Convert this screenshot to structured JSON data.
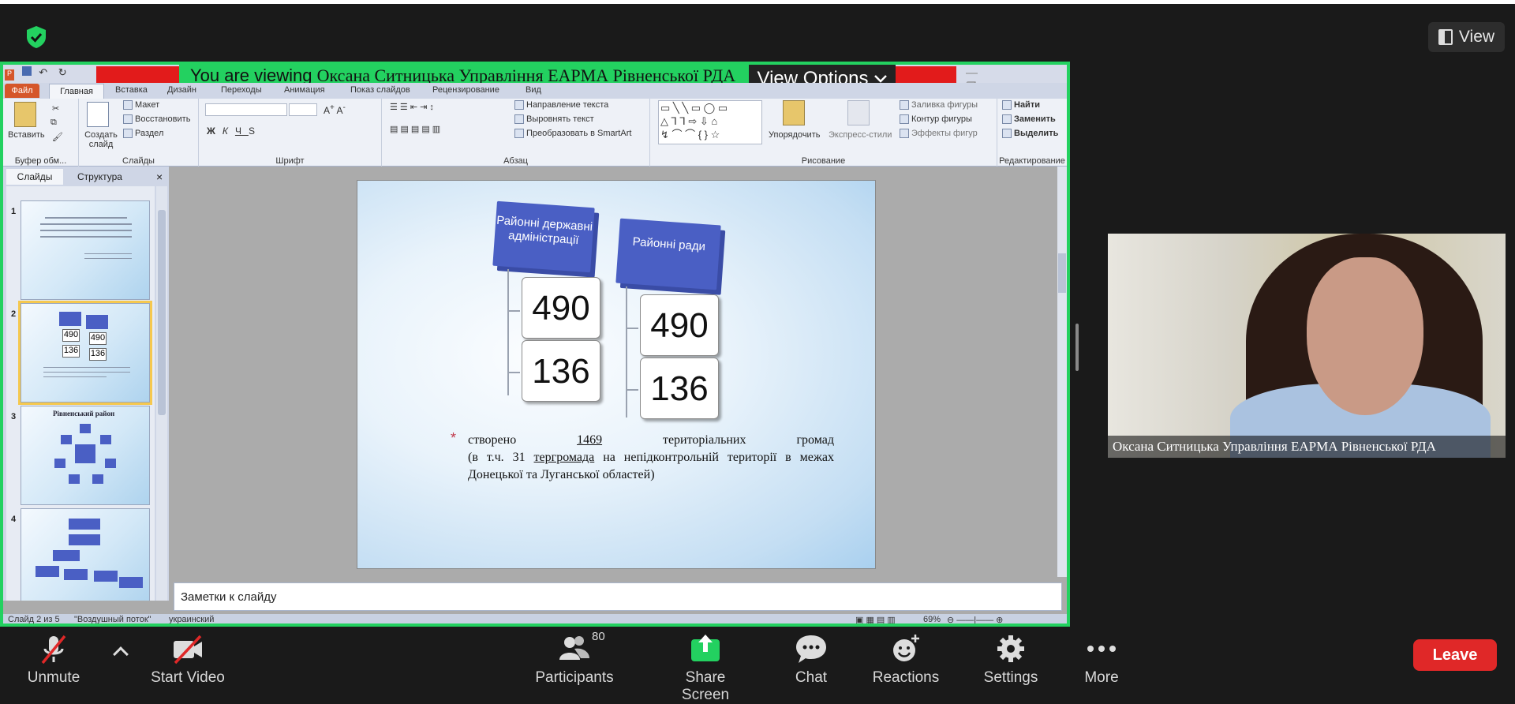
{
  "topbar": {
    "view_label": "View"
  },
  "share": {
    "viewing_prefix": "You are viewing",
    "viewing_name": "Оксана Ситницька Управління ЕАРМА Рівненської РДА",
    "view_options": "View Options"
  },
  "ppt": {
    "tabs": {
      "file": "Файл",
      "home": "Главная",
      "insert": "Вставка",
      "design": "Дизайн",
      "transitions": "Переходы",
      "animation": "Анимация",
      "slideshow": "Показ слайдов",
      "review": "Рецензирование",
      "view": "Вид"
    },
    "ribbon": {
      "paste": "Вставить",
      "clipboard": "Буфер обм...",
      "new_slide": "Создать слайд",
      "layout": "Макет",
      "reset": "Восстановить",
      "section": "Раздел",
      "slides_group": "Слайды",
      "font_group": "Шрифт",
      "text_dir": "Направление текста",
      "align_text": "Выровнять текст",
      "smartart": "Преобразовать в SmartArt",
      "paragraph_group": "Абзац",
      "arrange": "Упорядочить",
      "quick_styles": "Экспресс-стили",
      "shape_fill": "Заливка фигуры",
      "shape_outline": "Контур фигуры",
      "shape_effects": "Эффекты фигур",
      "drawing_group": "Рисование",
      "find": "Найти",
      "replace": "Заменить",
      "select": "Выделить",
      "editing_group": "Редактирование"
    },
    "pane": {
      "tab_slides": "Слайды",
      "tab_outline": "Структура",
      "close": "×"
    },
    "thumbs": [
      {
        "num": "1"
      },
      {
        "num": "2",
        "n1": "490",
        "n2": "490",
        "n3": "136",
        "n4": "136"
      },
      {
        "num": "3",
        "title": "Рівненський район"
      },
      {
        "num": "4"
      }
    ],
    "slide": {
      "panel1": "Районні державні адміністрації",
      "panel2": "Районні ради",
      "n1": "490",
      "n2": "136",
      "n3": "490",
      "n4": "136",
      "star": "*",
      "line1_a": "створено",
      "line1_b": "1469",
      "line1_c": "територіальних громад",
      "line2_a": "(в т.ч. 31",
      "line2_b": "тергромада",
      "line2_c": "на непідконтрольній території в межах Донецької та Луганської областей)"
    },
    "notes_placeholder": "Заметки к слайду",
    "status": {
      "slide": "Слайд 2 из 5",
      "theme": "\"Воздушный поток\"",
      "lang": "украинский",
      "zoom": "69%"
    }
  },
  "video": {
    "name": "Оксана Ситницька Управління ЕАРМА Рівненської РДА"
  },
  "toolbar": {
    "unmute": "Unmute",
    "start_video": "Start Video",
    "participants": "Participants",
    "participants_count": "80",
    "share_screen": "Share Screen",
    "chat": "Chat",
    "reactions": "Reactions",
    "settings": "Settings",
    "more": "More",
    "leave": "Leave"
  },
  "colors": {
    "accent_green": "#23d160",
    "leave_red": "#e02828",
    "ppt_blue": "#4a5fc4"
  }
}
